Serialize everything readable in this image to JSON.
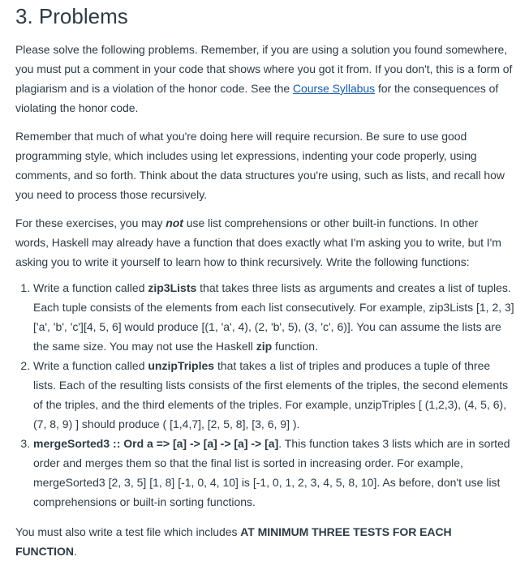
{
  "heading": "3. Problems",
  "para1": {
    "before_link": "Please solve the following problems. Remember, if you are using a solution you found somewhere, you must put a comment in your code that shows where you got it from. If you don't, this is a form of plagiarism and is a violation of the honor code. See the ",
    "link_text": "Course Syllabus",
    "after_link": " for the consequences of violating the honor code."
  },
  "para2": "Remember that much of what you're doing here will require recursion. Be sure to use good programming style, which includes using let expressions, indenting your code properly, using comments, and so forth. Think about the data structures you're using, such as lists, and recall how you need to process those recursively.",
  "para3": {
    "before": "For these exercises, you may ",
    "emphasis": "not",
    "after": " use list comprehensions or other built-in functions. In other words, Haskell may already have a function that does exactly what I'm asking you to write, but I'm asking you to write it yourself to learn how to think recursively. Write the following functions:"
  },
  "problems": [
    {
      "before": "Write a function called ",
      "name": "zip3Lists",
      "middle": " that takes three lists as arguments and creates a list of tuples. Each tuple consists of the elements from each list consecutively. For example, zip3Lists [1, 2, 3] ['a', 'b', 'c'][4, 5, 6] would produce [(1, 'a', 4), (2, 'b', 5), (3, 'c', 6)]. You can assume the lists are the same size. You may not use the Haskell ",
      "keyword": "zip",
      "after": " function."
    },
    {
      "before": "Write a function called ",
      "name": "unzipTriples",
      "after": " that takes a list of triples and produces a tuple of three lists. Each of the resulting lists consists of the first elements of the triples, the second elements of the triples, and the third elements of the triples. For example, unzipTriples [ (1,2,3), (4, 5, 6), (7, 8, 9) ] should produce ( [1,4,7], [2, 5, 8], [3, 6, 9] )."
    },
    {
      "signature": "mergeSorted3 :: Ord a => [a] -> [a] -> [a] -> [a]",
      "after": ". This function takes 3 lists which are in sorted order and merges them so that the final list is sorted in increasing order. For example, mergeSorted3 [2, 3, 5] [1, 8] [-1, 0, 4, 10] is [-1, 0, 1, 2, 3, 4, 5, 8, 10]. As before, don't use list comprehensions or built-in sorting functions."
    }
  ],
  "para4": {
    "before": "You must also write a test file which includes ",
    "emphasis": "AT MINIMUM THREE TESTS FOR EACH FUNCTION",
    "after": "."
  }
}
